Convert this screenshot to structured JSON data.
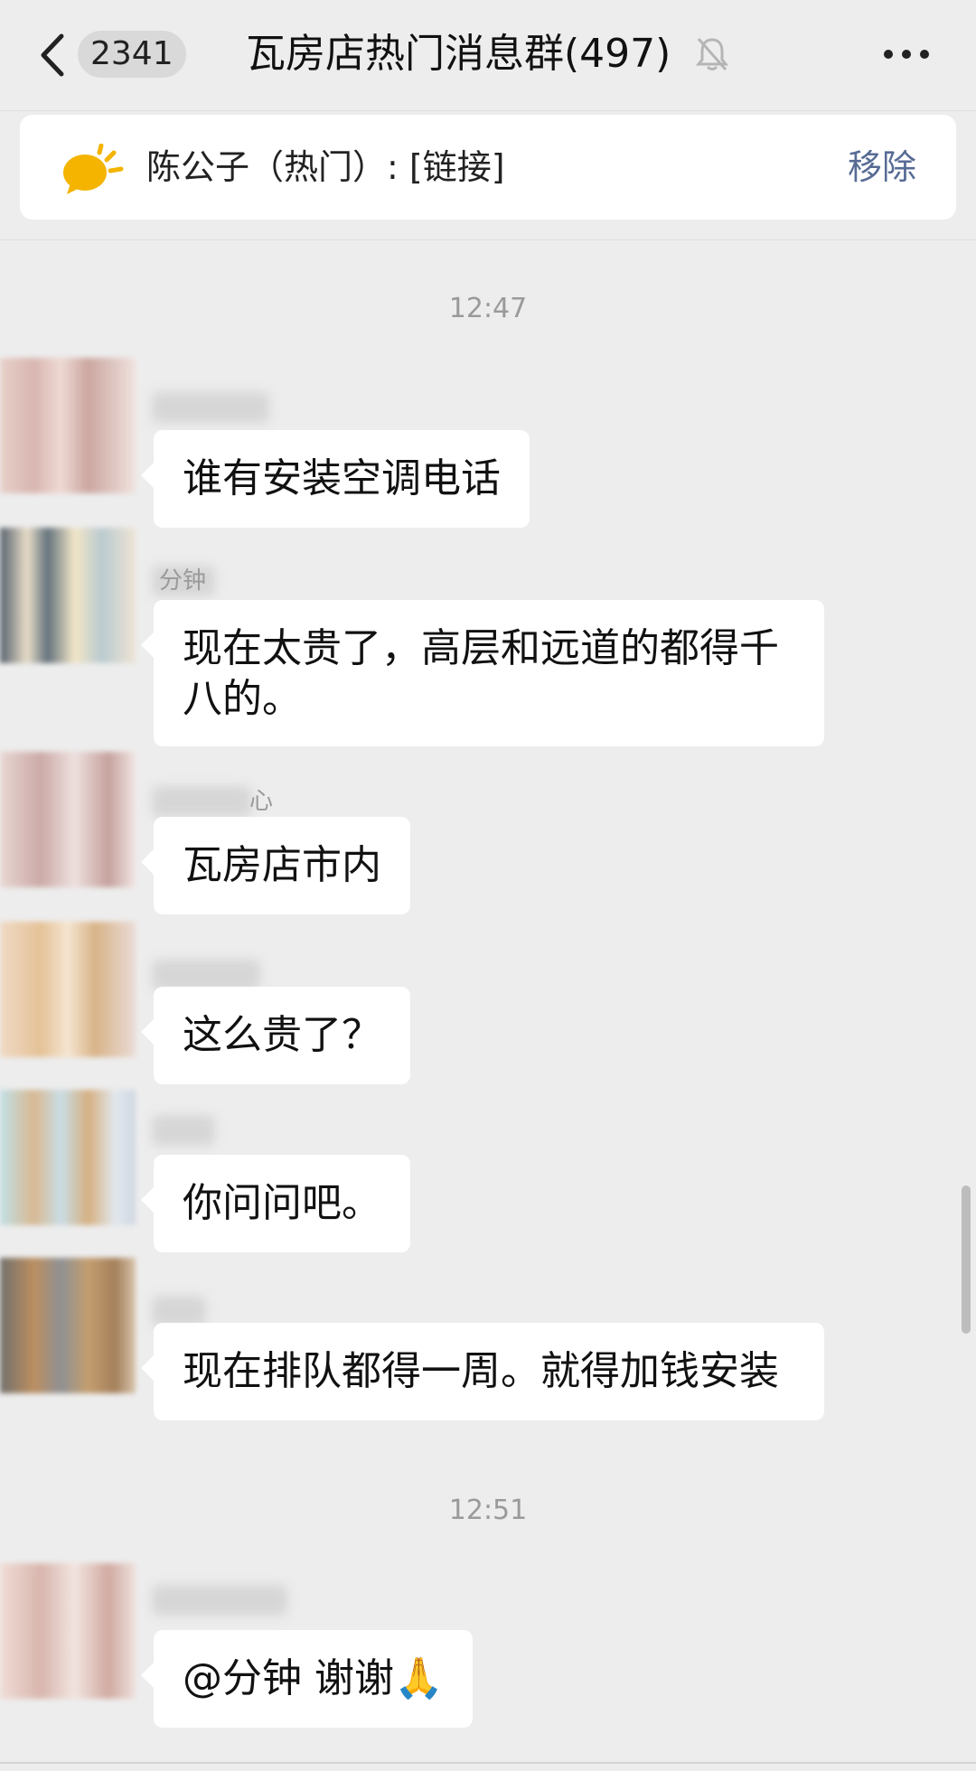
{
  "header": {
    "unread_count": "2341",
    "title": "瓦房店热门消息群(497)"
  },
  "pinned": {
    "text": "陈公子（热门）: [链接]",
    "remove_label": "移除"
  },
  "timestamps": [
    "12:47",
    "12:51"
  ],
  "messages": [
    {
      "sender_visible": "",
      "text": "谁有安装空调电话"
    },
    {
      "sender_visible": "分钟",
      "text": "现在太贵了，高层和远道的都得千八的。"
    },
    {
      "sender_visible": "心",
      "text": "瓦房店市内"
    },
    {
      "sender_visible": "",
      "text": "这么贵了？"
    },
    {
      "sender_visible": "",
      "text": "你问问吧。"
    },
    {
      "sender_visible": "",
      "text": "现在排队都得一周。就得加钱安装"
    },
    {
      "sender_visible": "",
      "text": "@分钟  谢谢🙏"
    }
  ],
  "colors": {
    "background": "#ededed",
    "bubble": "#ffffff",
    "link_blue": "#576b95",
    "timestamp_gray": "#9a9a9a"
  },
  "icons": {
    "back": "chevron-left-icon",
    "mute": "bell-off-icon",
    "more": "more-dots-icon",
    "pin": "speech-bubble-icon"
  }
}
